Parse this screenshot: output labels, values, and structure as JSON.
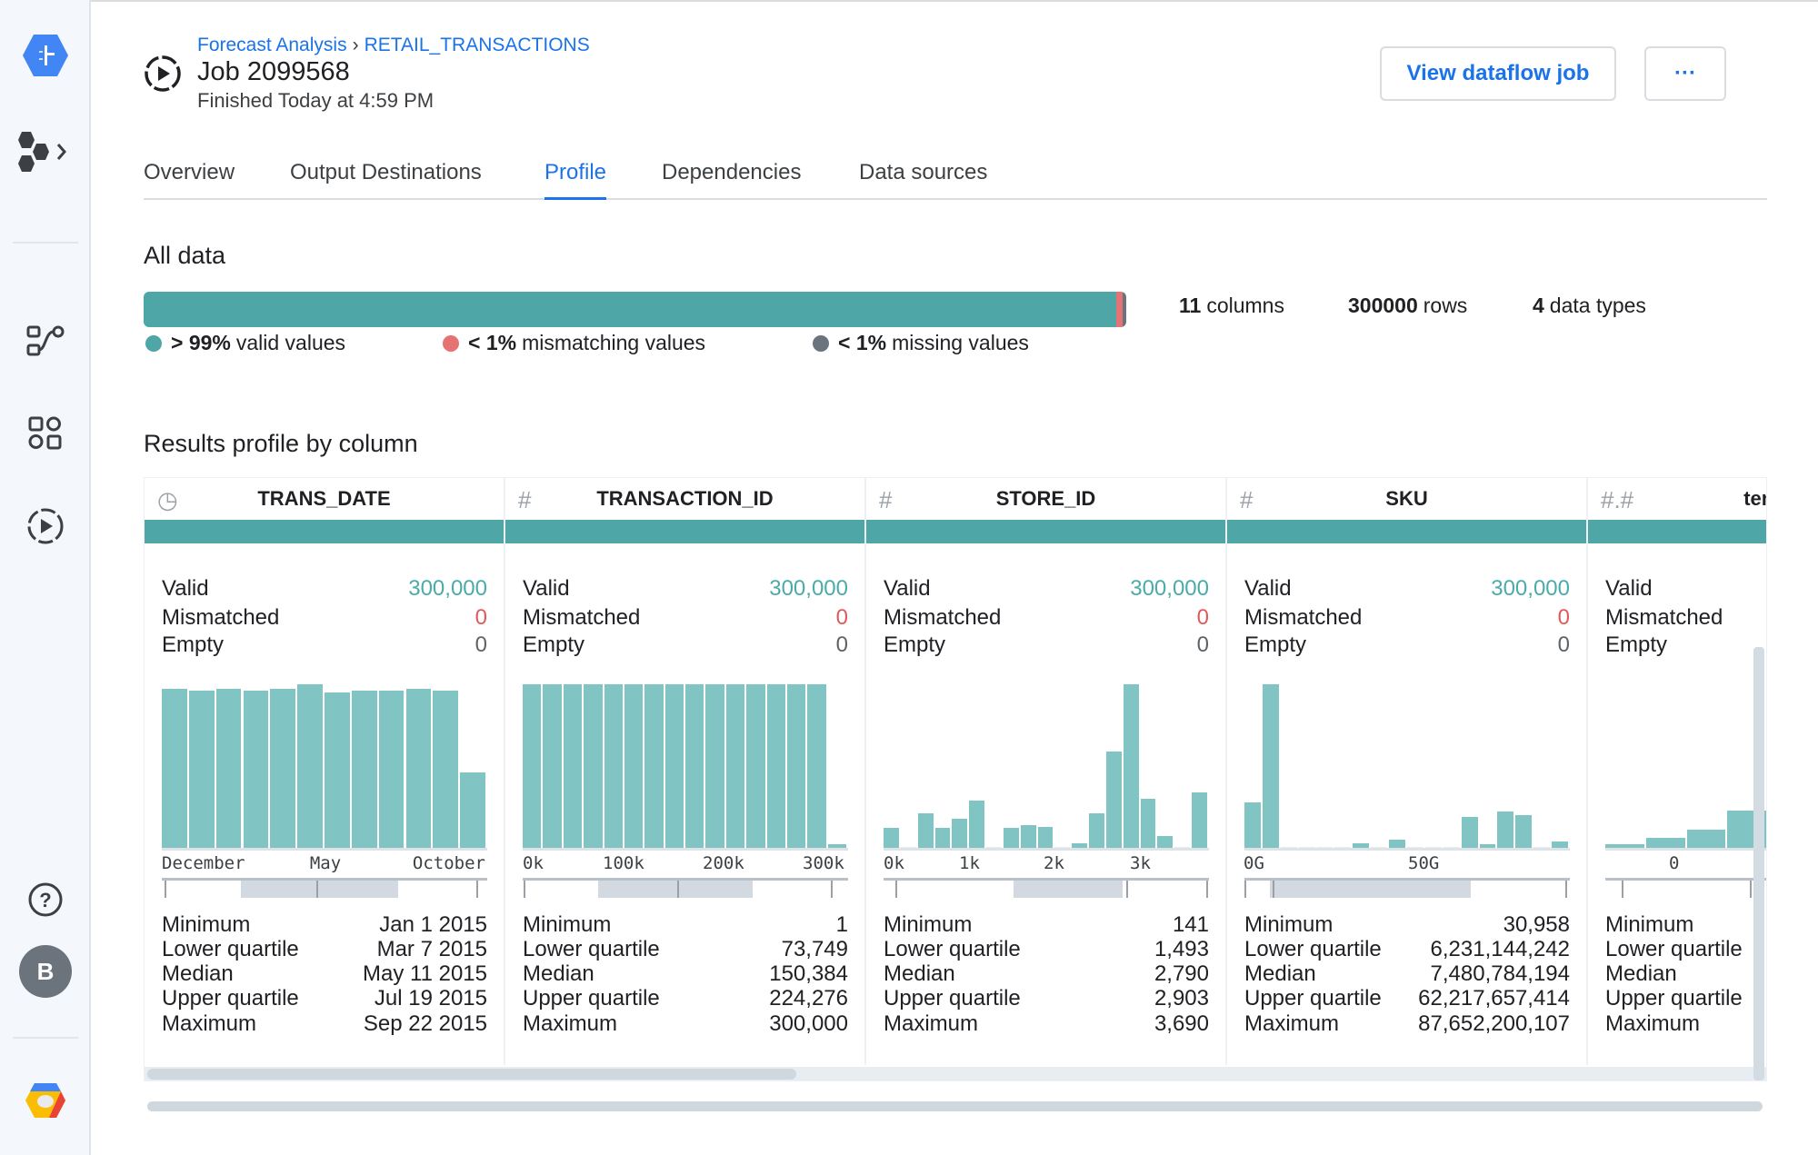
{
  "sidebar": {
    "items": [
      {
        "name": "dataprep-logo-icon"
      },
      {
        "name": "flows-expand-icon"
      },
      {
        "name": "flow-icon"
      },
      {
        "name": "library-icon"
      },
      {
        "name": "jobs-icon"
      },
      {
        "name": "help-icon"
      }
    ],
    "avatar_initial": "B"
  },
  "header": {
    "breadcrumb": [
      "Forecast Analysis",
      "RETAIL_TRANSACTIONS"
    ],
    "breadcrumb_sep": "›",
    "title": "Job 2099568",
    "subtitle": "Finished Today at 4:59 PM",
    "view_button": "View dataflow job",
    "more_button": "···"
  },
  "tabs": [
    {
      "label": "Overview"
    },
    {
      "label": "Output Destinations"
    },
    {
      "label": "Profile",
      "active": true
    },
    {
      "label": "Dependencies"
    },
    {
      "label": "Data sources"
    }
  ],
  "all_data": {
    "heading": "All data",
    "valid_pct": 99.0,
    "mismatch_pct": 0.6,
    "missing_pct": 0.4,
    "legend": [
      {
        "prefix": "> 99%",
        "label": "valid values",
        "color": "#4fa6a6"
      },
      {
        "prefix": "< 1%",
        "label": "mismatching values",
        "color": "#e57373"
      },
      {
        "prefix": "< 1%",
        "label": "missing values",
        "color": "#6b737c"
      }
    ],
    "stats": [
      {
        "value": "11",
        "label": "columns"
      },
      {
        "value": "300000",
        "label": "rows"
      },
      {
        "value": "4",
        "label": "data types"
      }
    ]
  },
  "profile": {
    "heading": "Results profile by column",
    "labels": {
      "valid": "Valid",
      "mismatched": "Mismatched",
      "empty": "Empty",
      "min": "Minimum",
      "lq": "Lower quartile",
      "median": "Median",
      "uq": "Upper quartile",
      "max": "Maximum"
    },
    "colors": {
      "valid": "#4aaba8",
      "mismatched": "#e05a5a",
      "bar": "#4fa6a6",
      "hist": "#80c4c3"
    },
    "columns": [
      {
        "name": "TRANS_DATE",
        "type_icon": "clock-icon",
        "valid": "300,000",
        "mismatched": "0",
        "empty": "0",
        "histogram": [
          97,
          96,
          97,
          96,
          97,
          100,
          95,
          96,
          96,
          97,
          96,
          46
        ],
        "axis": [
          "December",
          "May",
          "October"
        ],
        "stats": {
          "min": "Jan 1 2015",
          "lq": "Mar 7 2015",
          "median": "May 11 2015",
          "uq": "Jul 19 2015",
          "max": "Sep 22 2015"
        }
      },
      {
        "name": "TRANSACTION_ID",
        "type_icon": "hash-icon",
        "valid": "300,000",
        "mismatched": "0",
        "empty": "0",
        "histogram": [
          100,
          100,
          100,
          100,
          100,
          100,
          100,
          100,
          100,
          100,
          100,
          100,
          100,
          100,
          100,
          2
        ],
        "axis": [
          "0k",
          "100k",
          "200k",
          "300k"
        ],
        "stats": {
          "min": "1",
          "lq": "73,749",
          "median": "150,384",
          "uq": "224,276",
          "max": "300,000"
        }
      },
      {
        "name": "STORE_ID",
        "type_icon": "hash-icon",
        "valid": "300,000",
        "mismatched": "0",
        "empty": "0",
        "histogram": [
          12,
          0.5,
          21,
          12,
          18,
          29,
          0.5,
          12,
          14,
          13,
          0.5,
          3,
          21,
          59,
          100,
          30,
          7,
          0.5,
          34
        ],
        "axis": [
          "0k",
          "1k",
          "2k",
          "3k"
        ],
        "stats": {
          "min": "141",
          "lq": "1,493",
          "median": "2,790",
          "uq": "2,903",
          "max": "3,690"
        }
      },
      {
        "name": "SKU",
        "type_icon": "hash-icon",
        "valid": "300,000",
        "mismatched": "0",
        "empty": "0",
        "histogram": [
          28,
          100,
          0.5,
          0.5,
          0.5,
          0.5,
          3,
          0.5,
          5,
          0.5,
          0.5,
          0.5,
          19,
          2,
          22,
          20,
          0.5,
          4
        ],
        "axis": [
          "0G",
          "50G"
        ],
        "stats": {
          "min": "30,958",
          "lq": "6,231,144,242",
          "median": "7,480,784,194",
          "uq": "62,217,657,414",
          "max": "87,652,200,107"
        }
      },
      {
        "name": "temp",
        "type_icon": "decimal-icon",
        "valid": "",
        "mismatched": "",
        "empty": "",
        "histogram": [
          2,
          6,
          11,
          23,
          20,
          32,
          28
        ],
        "axis": [
          "0"
        ],
        "stats": {
          "min": "",
          "lq": "",
          "median": "",
          "uq": "",
          "max": ""
        }
      }
    ]
  }
}
